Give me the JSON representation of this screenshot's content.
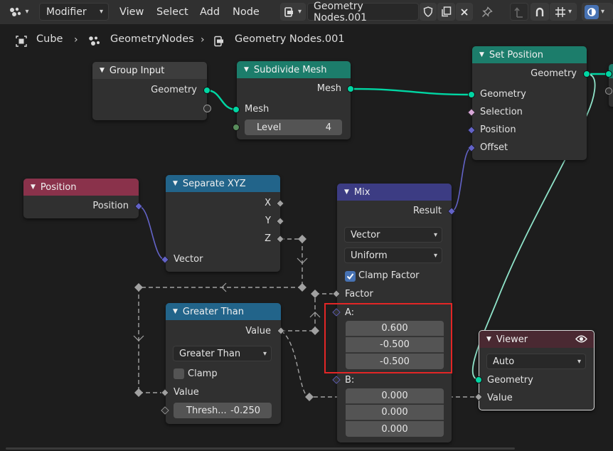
{
  "header": {
    "editor_type_icon": "node-editor-icon",
    "context_dropdown": "Modifier",
    "menus": [
      "View",
      "Select",
      "Add",
      "Node"
    ],
    "node_tree_name": "Geometry Nodes.001",
    "icons": [
      "node-tree-type-icon",
      "fake-user-shield-icon",
      "duplicate-icon",
      "close-icon",
      "pin-icon",
      "parent-node-tree-icon",
      "snap-magnet-icon",
      "grid-snap-icon",
      "overlay-icon"
    ]
  },
  "breadcrumb": {
    "items": [
      "Cube",
      "GeometryNodes",
      "Geometry Nodes.001"
    ],
    "icons": [
      "mesh-object-icon",
      "modifier-nodes-icon",
      "node-tree-icon"
    ]
  },
  "nodes": {
    "group_input": {
      "title": "Group Input",
      "geometry": "Geometry"
    },
    "subdivide": {
      "title": "Subdivide Mesh",
      "mesh_out": "Mesh",
      "mesh_in": "Mesh",
      "level_label": "Level",
      "level_value": "4"
    },
    "set_position": {
      "title": "Set Position",
      "geometry_out": "Geometry",
      "geometry_in": "Geometry",
      "selection": "Selection",
      "position": "Position",
      "offset": "Offset"
    },
    "position": {
      "title": "Position",
      "output": "Position"
    },
    "separate_xyz": {
      "title": "Separate XYZ",
      "x": "X",
      "y": "Y",
      "z": "Z",
      "vector": "Vector"
    },
    "mix": {
      "title": "Mix",
      "result": "Result",
      "data_type": "Vector",
      "factor_mode": "Uniform",
      "clamp_factor": "Clamp Factor",
      "factor": "Factor",
      "a_label": "A:",
      "a_values": [
        "0.600",
        "-0.500",
        "-0.500"
      ],
      "b_label": "B:",
      "b_values": [
        "0.000",
        "0.000",
        "0.000"
      ]
    },
    "greater_than": {
      "title": "Greater Than",
      "value_out": "Value",
      "operation": "Greater Than",
      "clamp": "Clamp",
      "value_in": "Value",
      "threshold_label": "Thresh...",
      "threshold_value": "-0.250"
    },
    "viewer": {
      "title": "Viewer",
      "domain": "Auto",
      "geometry": "Geometry",
      "value": "Value"
    }
  },
  "colors": {
    "geometry_socket": "#00d6a3",
    "vector_socket": "#6363c7",
    "float_socket": "#a1a1a1",
    "int_socket": "#598c5c",
    "selection_highlight": "#e32626",
    "mix_header": "#3c3c83"
  }
}
